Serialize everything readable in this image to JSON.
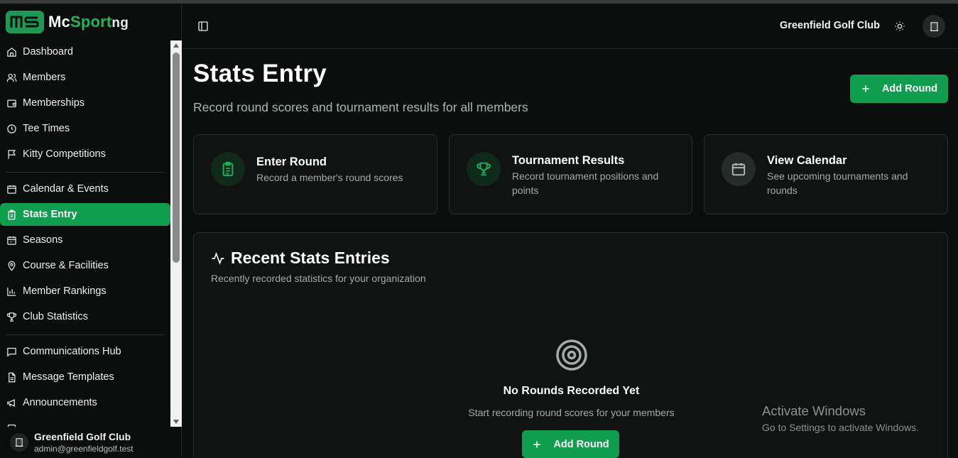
{
  "brand": {
    "prefix": "Mc",
    "highlight": "Sport",
    "suffix": "ng",
    "accent": "#1fb55f"
  },
  "sidebar": {
    "items": [
      {
        "label": "Dashboard",
        "icon": "home-icon"
      },
      {
        "label": "Members",
        "icon": "users-icon"
      },
      {
        "label": "Memberships",
        "icon": "wallet-icon"
      },
      {
        "label": "Tee Times",
        "icon": "clock-icon"
      },
      {
        "label": "Kitty Competitions",
        "icon": "flag-icon"
      },
      {
        "label": "Calendar & Events",
        "icon": "calendar-icon"
      },
      {
        "label": "Stats Entry",
        "icon": "clipboard-icon",
        "active": true
      },
      {
        "label": "Seasons",
        "icon": "calendar-grid-icon"
      },
      {
        "label": "Course & Facilities",
        "icon": "map-pin-icon"
      },
      {
        "label": "Member Rankings",
        "icon": "bar-chart-icon"
      },
      {
        "label": "Club Statistics",
        "icon": "trophy-icon"
      },
      {
        "label": "Communications Hub",
        "icon": "message-square-icon"
      },
      {
        "label": "Message Templates",
        "icon": "file-text-icon"
      },
      {
        "label": "Announcements",
        "icon": "megaphone-icon"
      }
    ],
    "org_name": "Greenfield Golf Club",
    "org_email": "admin@greenfieldgolf.test"
  },
  "header": {
    "club_name": "Greenfield Golf Club"
  },
  "main": {
    "title": "Stats Entry",
    "subtitle": "Record round scores and tournament results for all members",
    "add_round_label": "Add Round",
    "cards": [
      {
        "title": "Enter Round",
        "description": "Record a member's round scores"
      },
      {
        "title": "Tournament Results",
        "description": "Record tournament positions and points"
      },
      {
        "title": "View Calendar",
        "description": "See upcoming tournaments and rounds"
      }
    ],
    "recent": {
      "title": "Recent Stats Entries",
      "subtitle": "Recently recorded statistics for your organization",
      "empty_title": "No Rounds Recorded Yet",
      "empty_description": "Start recording round scores for your members",
      "add_round_label": "Add Round"
    }
  },
  "watermark": {
    "line1": "Activate Windows",
    "line2": "Go to Settings to activate Windows."
  },
  "colors": {
    "primary": "#0f9d4e",
    "background": "#0c0e0d",
    "card": "#101312"
  }
}
